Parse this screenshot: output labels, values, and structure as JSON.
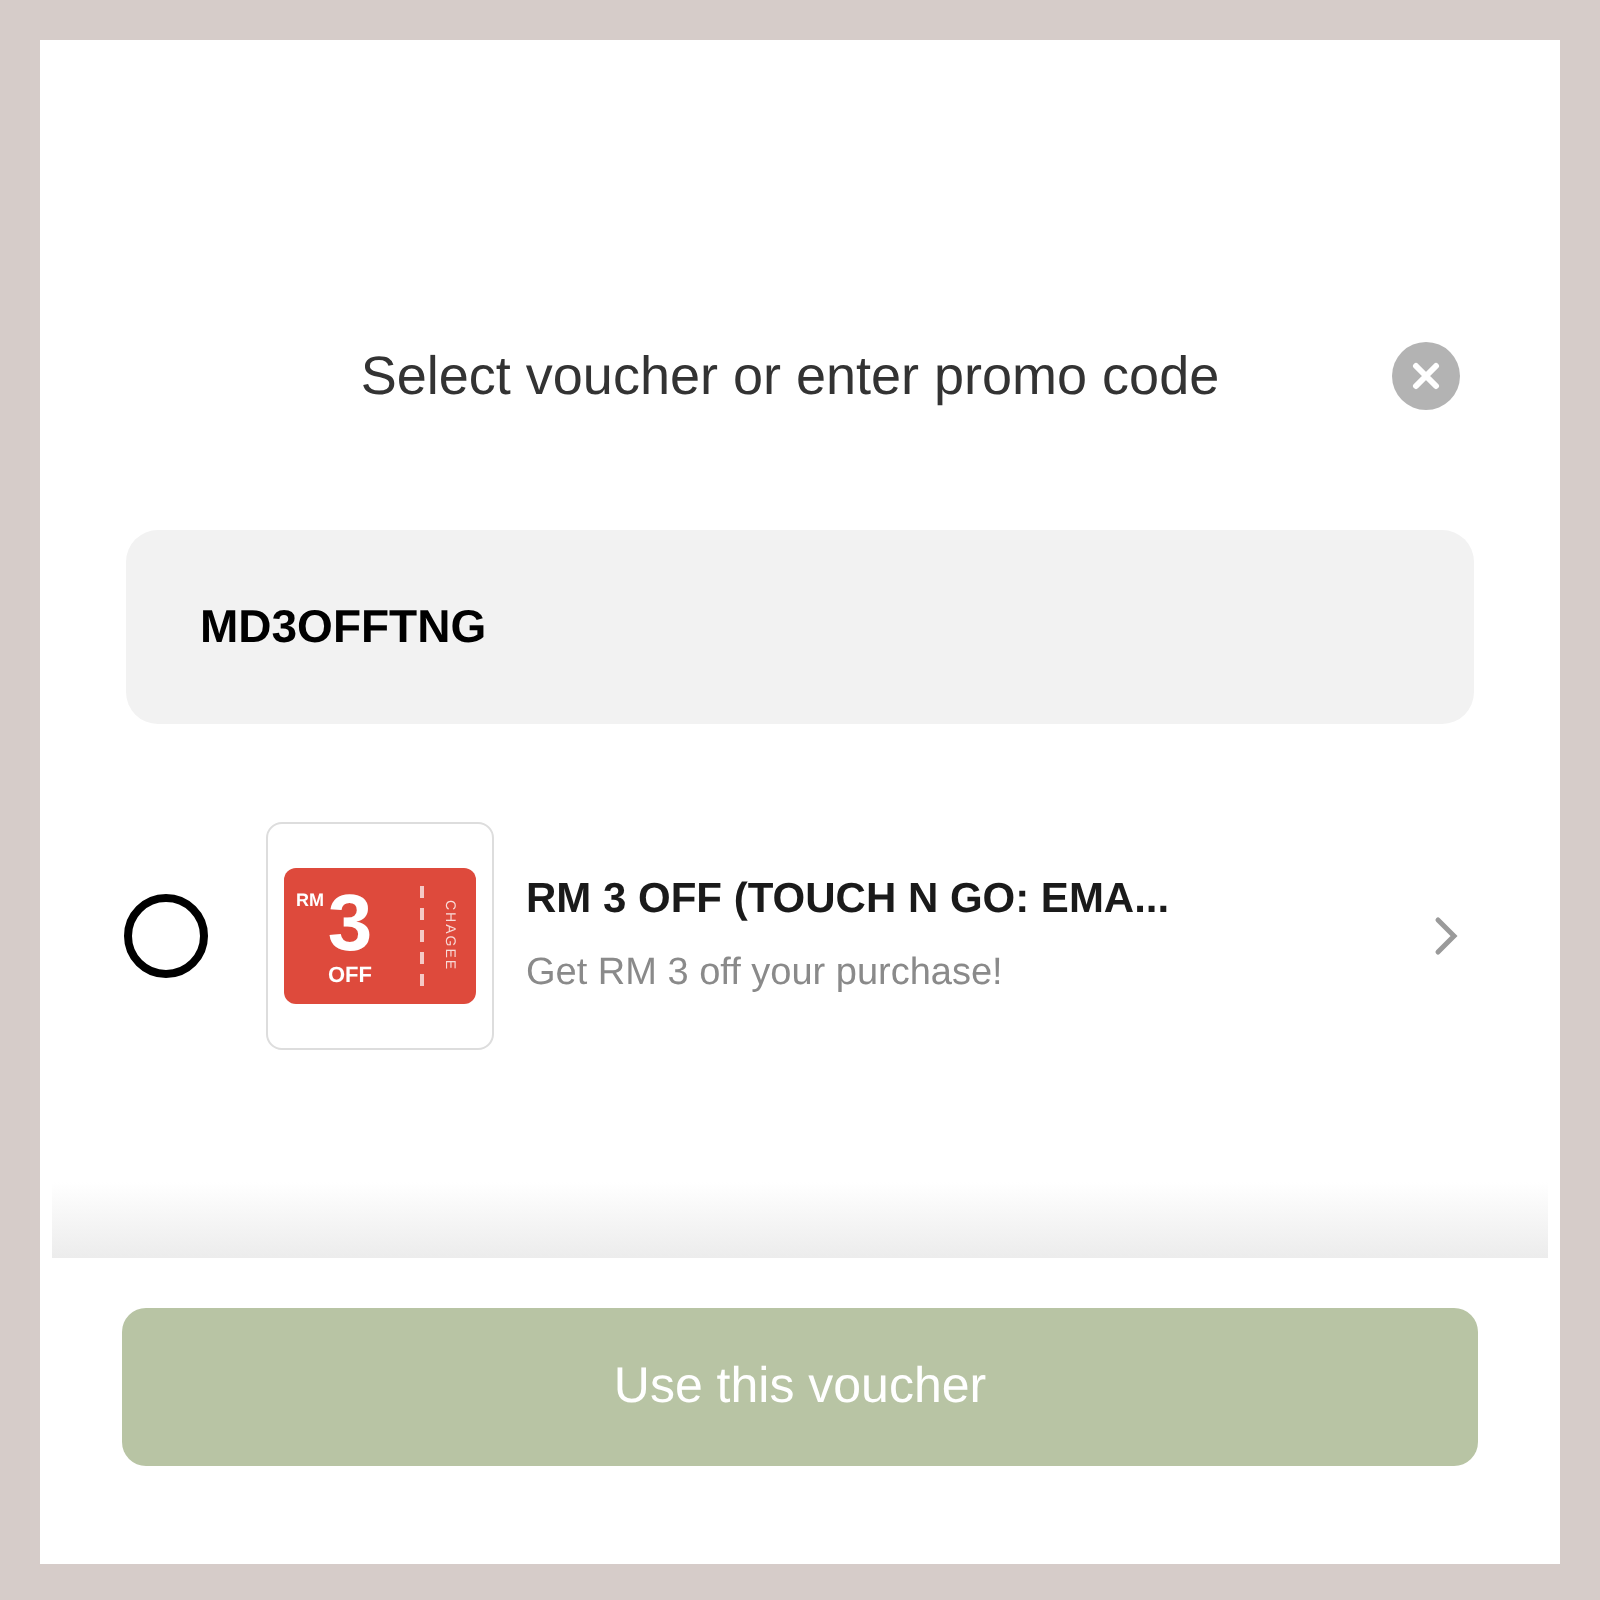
{
  "dialog": {
    "title": "Select voucher or enter promo code"
  },
  "promo_field": {
    "value": "MD3OFFTNG"
  },
  "vouchers": [
    {
      "selected": false,
      "thumbnail": {
        "currency": "RM",
        "amount": "3",
        "off": "OFF",
        "brand": "CHAGEE"
      },
      "title": "RM 3 OFF (TOUCH N GO: EMA...",
      "subtitle": "Get RM 3 off your purchase!"
    }
  ],
  "primary_button": {
    "label": "Use this voucher"
  }
}
